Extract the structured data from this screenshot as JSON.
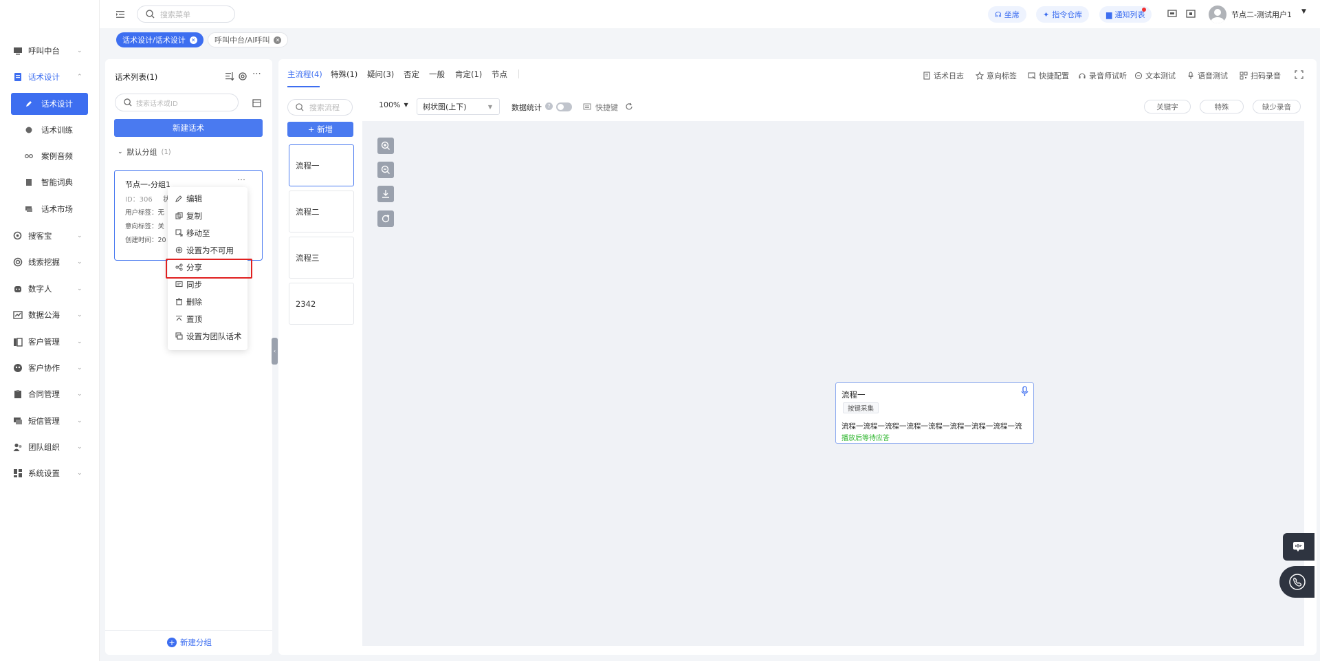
{
  "sidebar": {
    "items": [
      {
        "label": "呼叫中台",
        "icon": "monitor-icon"
      },
      {
        "label": "话术设计",
        "icon": "document-icon",
        "open": true
      },
      {
        "label": "搜客宝",
        "icon": "search-circle-icon"
      },
      {
        "label": "线索挖掘",
        "icon": "target-icon"
      },
      {
        "label": "数字人",
        "icon": "robot-icon"
      },
      {
        "label": "数据公海",
        "icon": "chart-icon"
      },
      {
        "label": "客户管理",
        "icon": "customer-icon"
      },
      {
        "label": "客户协作",
        "icon": "collab-icon"
      },
      {
        "label": "合同管理",
        "icon": "clipboard-icon"
      },
      {
        "label": "短信管理",
        "icon": "message-icon"
      },
      {
        "label": "团队组织",
        "icon": "team-icon"
      },
      {
        "label": "系统设置",
        "icon": "grid-icon"
      }
    ],
    "subitems": [
      {
        "label": "话术设计",
        "icon": "edit-icon",
        "active": true
      },
      {
        "label": "话术训练",
        "icon": "chat-icon"
      },
      {
        "label": "案例音频",
        "icon": "audio-icon"
      },
      {
        "label": "智能词典",
        "icon": "book-icon"
      },
      {
        "label": "话术市场",
        "icon": "store-icon"
      }
    ]
  },
  "topbar": {
    "search_placeholder": "搜索菜单",
    "btn_agent": "坐席",
    "btn_command": "指令仓库",
    "btn_notify": "通知列表",
    "user_name": "节点二-测试用户1"
  },
  "tabs": [
    {
      "label": "话术设计/话术设计",
      "active": true
    },
    {
      "label": "呼叫中台/AI呼叫",
      "active": false
    }
  ],
  "left_panel": {
    "title": "话术列表(1)",
    "search_placeholder": "搜索话术或ID",
    "new_button": "新建话术",
    "group_name": "默认分组",
    "group_count": "(1)",
    "card": {
      "title": "节点一-分组1",
      "id_line": "ID：306",
      "status_prefix": "状",
      "user_tag_label": "用户标签：",
      "user_tag_value": "无",
      "intent_tag_label": "意向标签：",
      "intent_tag_value": "关",
      "created_label": "创建时间：",
      "created_value": "20"
    },
    "new_group": "新建分组"
  },
  "context_menu": [
    {
      "label": "编辑",
      "icon": "edit-icon"
    },
    {
      "label": "复制",
      "icon": "copy-icon"
    },
    {
      "label": "移动至",
      "icon": "move-icon"
    },
    {
      "label": "设置为不可用",
      "icon": "settings-icon"
    },
    {
      "label": "分享",
      "icon": "share-icon",
      "highlighted": true
    },
    {
      "label": "同步",
      "icon": "sync-icon"
    },
    {
      "label": "删除",
      "icon": "trash-icon"
    },
    {
      "label": "置顶",
      "icon": "pin-top-icon"
    },
    {
      "label": "设置为团队话术",
      "icon": "team-copy-icon"
    }
  ],
  "right_panel": {
    "subtabs": [
      "主流程(4)",
      "特殊(1)",
      "疑问(3)",
      "否定",
      "一般",
      "肯定(1)",
      "节点"
    ],
    "tools": [
      "话术日志",
      "意向标签",
      "快捷配置",
      "录音师试听",
      "文本测试",
      "语音测试",
      "扫码录音"
    ],
    "flow_search_placeholder": "搜索流程",
    "add_button": "+ 新增",
    "flows": [
      "流程一",
      "流程二",
      "流程三",
      "2342"
    ],
    "zoom": "100%",
    "layout_select": "树状图(上下)",
    "data_stats": "数据统计",
    "shortcut": "快捷键",
    "pills": [
      "关键字",
      "特殊",
      "缺少录音"
    ]
  },
  "node": {
    "title": "流程一",
    "tag": "按键采集",
    "text": "流程一流程一流程一流程一流程一流程一流程一流程一流",
    "status": "播放后等待应答"
  },
  "colors": {
    "primary": "#3d6ef0",
    "highlight_border": "#e02020",
    "status_green": "#2db52d"
  }
}
